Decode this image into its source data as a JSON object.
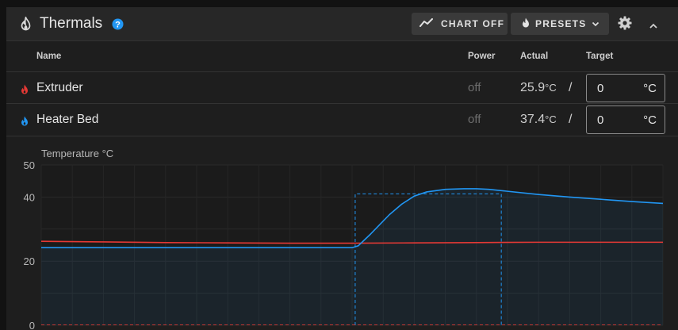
{
  "header": {
    "title": "Thermals",
    "chart_button": "CHART OFF",
    "presets_button": "PRESETS"
  },
  "table": {
    "columns": {
      "name": "Name",
      "power": "Power",
      "actual": "Actual",
      "target": "Target"
    },
    "rows": [
      {
        "name": "Extruder",
        "power": "off",
        "actual": "25.9",
        "actual_unit": "°C",
        "slash": "/",
        "target": "0",
        "target_unit": "°C",
        "color": "#e53935"
      },
      {
        "name": "Heater Bed",
        "power": "off",
        "actual": "37.4",
        "actual_unit": "°C",
        "slash": "/",
        "target": "0",
        "target_unit": "°C",
        "color": "#2196f3"
      }
    ]
  },
  "chart_data": {
    "type": "line",
    "title": "Temperature °C",
    "ylim": [
      0,
      50
    ],
    "yticks": [
      "0",
      "20",
      "40",
      "50"
    ],
    "grid": true,
    "series": [
      {
        "name": "Extruder",
        "color": "#e53935",
        "x": [
          0,
          10,
          20,
          30,
          40,
          50,
          60,
          70,
          80,
          90,
          100
        ],
        "values": [
          26.2,
          26.0,
          25.8,
          25.7,
          25.6,
          25.6,
          25.7,
          25.8,
          25.9,
          25.9,
          25.9
        ]
      },
      {
        "name": "Heater Bed",
        "color": "#2196f3",
        "x": [
          0,
          10,
          20,
          30,
          40,
          50,
          51,
          53,
          56,
          58,
          60,
          62,
          65,
          68,
          70,
          72,
          75,
          80,
          85,
          90,
          95,
          100
        ],
        "values": [
          24.2,
          24.2,
          24.2,
          24.2,
          24.2,
          24.2,
          24.8,
          28.5,
          34.5,
          37.8,
          40.3,
          41.6,
          42.4,
          42.6,
          42.6,
          42.4,
          41.8,
          40.8,
          40.0,
          39.3,
          38.6,
          38.0
        ]
      }
    ],
    "target_box": {
      "x_start": 50.5,
      "x_end": 74.0,
      "value": 41
    }
  }
}
